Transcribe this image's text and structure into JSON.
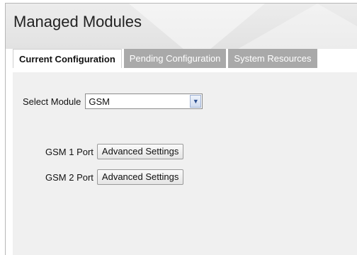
{
  "page_title": "Managed Modules",
  "tabs": [
    {
      "label": "Current Configuration",
      "active": true
    },
    {
      "label": "Pending Configuration",
      "active": false
    },
    {
      "label": "System Resources",
      "active": false
    }
  ],
  "module_select": {
    "label": "Select Module",
    "value": "GSM"
  },
  "ports": [
    {
      "label": "GSM 1 Port",
      "button": "Advanced Settings"
    },
    {
      "label": "GSM 2 Port",
      "button": "Advanced Settings"
    }
  ]
}
